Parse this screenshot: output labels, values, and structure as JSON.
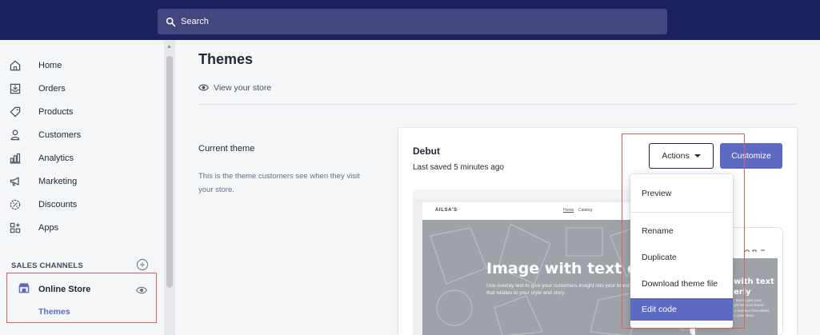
{
  "topbar": {
    "search_label": "Search"
  },
  "sidebar": {
    "items": [
      {
        "label": "Home",
        "icon": "home-icon"
      },
      {
        "label": "Orders",
        "icon": "orders-icon"
      },
      {
        "label": "Products",
        "icon": "tag-icon"
      },
      {
        "label": "Customers",
        "icon": "person-icon"
      },
      {
        "label": "Analytics",
        "icon": "bar-chart-icon"
      },
      {
        "label": "Marketing",
        "icon": "megaphone-icon"
      },
      {
        "label": "Discounts",
        "icon": "discount-icon"
      },
      {
        "label": "Apps",
        "icon": "apps-grid-icon"
      }
    ],
    "channels_heading": "SALES CHANNELS",
    "online_store": {
      "label": "Online Store",
      "sub_label": "Themes"
    }
  },
  "main": {
    "title": "Themes",
    "view_store": "View your store",
    "current_theme": {
      "heading": "Current theme",
      "description": "This is the theme customers see when they visit your store."
    },
    "card": {
      "theme_name": "Debut",
      "last_saved": "Last saved 5 minutes ago",
      "actions_label": "Actions",
      "customize_label": "Customize",
      "preview": {
        "brand": "AILSA'S",
        "nav": [
          "Home",
          "Catalog"
        ],
        "hero_title": "Image with text ove",
        "hero_text": "Use overlay text to give your customers insight into your brand. Select imagery and text that relates to your style and story.",
        "mobile_title": "with text\nerly",
        "mobile_text": "r text to give your\nght into your brand.\nry and text that relates\nto your story."
      }
    },
    "actions_menu": [
      "Preview",
      "Rename",
      "Duplicate",
      "Download theme file",
      "Edit code"
    ]
  },
  "colors": {
    "topbar": "#1c2260",
    "accent": "#5c6ac4",
    "highlight": "#e35b5b"
  }
}
